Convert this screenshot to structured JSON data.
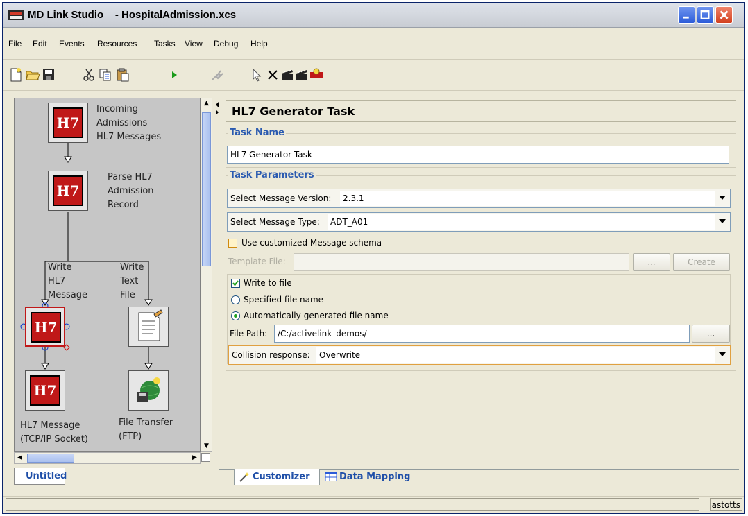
{
  "window": {
    "app_name": "MD Link Studio",
    "document": "- HospitalAdmission.xcs"
  },
  "menu": [
    "File",
    "Edit",
    "Events",
    "Resources",
    "Tasks",
    "View",
    "Debug",
    "Help"
  ],
  "toolbar": {
    "icons": [
      "new-document-icon",
      "open-folder-icon",
      "save-icon",
      "cut-icon",
      "copy-icon",
      "paste-icon",
      "run-icon",
      "plug-icon",
      "pointer-icon",
      "delete-icon",
      "clapper-icon",
      "clapper-2-icon",
      "connector-icon"
    ]
  },
  "workflow": {
    "nodes": [
      {
        "label_lines": [
          "Incoming",
          "Admissions",
          "HL7 Messages"
        ]
      },
      {
        "label_lines": [
          "Parse HL7",
          "Admission",
          "Record"
        ]
      },
      {
        "label_lines": [
          "HL7 Message",
          "(TCP/IP Socket)"
        ]
      },
      {
        "label_lines": [
          "File Transfer",
          "(FTP)"
        ]
      }
    ],
    "branch_left": [
      "Write",
      "HL7",
      "Message"
    ],
    "branch_right": [
      "Write",
      "Text",
      "File"
    ],
    "tab": "Untitled"
  },
  "task": {
    "header": "HL7 Generator Task",
    "name_group_label": "Task Name",
    "name_value": "HL7 Generator Task",
    "params_group_label": "Task Parameters",
    "version_label": "Select Message Version:",
    "version_value": "2.3.1",
    "type_label": "Select Message Type:",
    "type_value": "ADT_A01",
    "custom_schema_label": "Use customized Message schema",
    "template_label": "Template File:",
    "browse_label": "...",
    "create_label": "Create",
    "write_to_file_label": "Write to file",
    "specified_label": "Specified file name",
    "auto_label": "Automatically-generated file name",
    "filepath_label": "File Path:",
    "filepath_value": "/C:/activelink_demos/",
    "filepath_browse": "...",
    "collision_label": "Collision response:",
    "collision_value": "Overwrite"
  },
  "bottom_tabs": {
    "customizer": "Customizer",
    "data_mapping": "Data Mapping"
  },
  "status": {
    "user": "astotts"
  }
}
